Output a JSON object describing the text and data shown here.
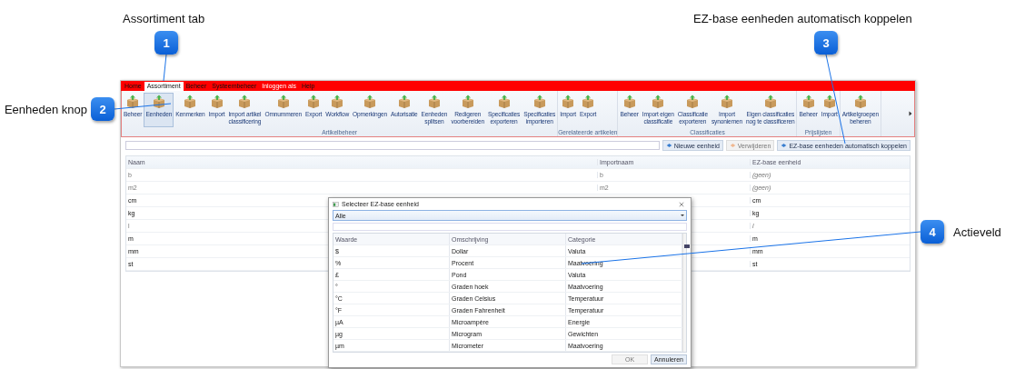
{
  "callouts": [
    {
      "number": "1",
      "label": "Assortiment tab"
    },
    {
      "number": "2",
      "label": "Eenheden knop"
    },
    {
      "number": "3",
      "label": "EZ-base eenheden automatisch koppelen"
    },
    {
      "number": "4",
      "label": "Actieveld"
    }
  ],
  "menu_tabs": [
    {
      "label": "Home",
      "selected": false,
      "disabled": false
    },
    {
      "label": "Assortiment",
      "selected": true,
      "disabled": false
    },
    {
      "label": "Beheer",
      "selected": false,
      "disabled": false
    },
    {
      "label": "Systeembeheer",
      "selected": false,
      "disabled": false
    },
    {
      "label": "Inloggen als",
      "selected": false,
      "disabled": true
    },
    {
      "label": "Help",
      "selected": false,
      "disabled": false
    }
  ],
  "ribbon_groups": [
    {
      "label": "Artikelbeheer",
      "buttons": [
        {
          "label": "Beheer",
          "selected": false
        },
        {
          "label": "Eenheden",
          "selected": true
        },
        {
          "label": "Kenmerken",
          "selected": false
        },
        {
          "label": "Import",
          "selected": false
        },
        {
          "label": "Import artikel\nclassificering",
          "selected": false
        },
        {
          "label": "Omnummeren",
          "selected": false
        },
        {
          "label": "Export",
          "selected": false
        },
        {
          "label": "Workflow",
          "selected": false
        },
        {
          "label": "Opmerkingen",
          "selected": false
        },
        {
          "label": "Autorisatie",
          "selected": false
        },
        {
          "label": "Eenheden\nsplitsen",
          "selected": false
        },
        {
          "label": "Redigeren\nvoorbereiden",
          "selected": false
        },
        {
          "label": "Specificaties\nexporteren",
          "selected": false
        },
        {
          "label": "Specificaties\nimporteren",
          "selected": false
        }
      ]
    },
    {
      "label": "Gerelateerde artikelen",
      "buttons": [
        {
          "label": "Import",
          "selected": false
        },
        {
          "label": "Export",
          "selected": false
        }
      ]
    },
    {
      "label": "Classificaties",
      "buttons": [
        {
          "label": "Beheer",
          "selected": false
        },
        {
          "label": "Import eigen\nclassificatie",
          "selected": false
        },
        {
          "label": "Classificatie\nexporteren",
          "selected": false
        },
        {
          "label": "Import\nsynoniemen",
          "selected": false
        },
        {
          "label": "Eigen classificaties\nnog te classificeren",
          "selected": false
        }
      ]
    },
    {
      "label": "Prijslijsten",
      "buttons": [
        {
          "label": "Beheer",
          "selected": false
        },
        {
          "label": "Import",
          "selected": false
        }
      ]
    },
    {
      "buttons": [
        {
          "label": "Artikelgroepen\nbeheren",
          "selected": false
        }
      ]
    }
  ],
  "toolbar": {
    "buttons": [
      {
        "label": "Nieuwe eenheid",
        "disabled": false
      },
      {
        "label": "Verwijderen",
        "disabled": true
      },
      {
        "label": "EZ-base eenheden automatisch koppelen",
        "disabled": false
      }
    ]
  },
  "table": {
    "columns": [
      "Naam",
      "Importnaam",
      "EZ-base eenheid"
    ],
    "rows": [
      {
        "naam": "b",
        "importnaam": "b",
        "ez_base": "(geen)",
        "disabled": true
      },
      {
        "naam": "m2",
        "importnaam": "m2",
        "ez_base": "(geen)",
        "disabled": true
      },
      {
        "naam": "cm",
        "ez_base": "cm",
        "disabled": false
      },
      {
        "naam": "kg",
        "ez_base": "kg",
        "disabled": false
      },
      {
        "naam": "l",
        "ez_base": "l",
        "disabled": true
      },
      {
        "naam": "m",
        "ez_base": "m",
        "disabled": false
      },
      {
        "naam": "mm",
        "ez_base": "mm",
        "disabled": false
      },
      {
        "naam": "st",
        "ez_base": "st",
        "disabled": false
      }
    ]
  },
  "dialog": {
    "title": "Selecteer EZ-base eenheid",
    "filter": "Alle",
    "columns": [
      "Waarde",
      "Omschrijving",
      "Categorie"
    ],
    "rows": [
      [
        "$",
        "Dollar",
        "Valuta"
      ],
      [
        "%",
        "Procent",
        "Maatvoering"
      ],
      [
        "£",
        "Pond",
        "Valuta"
      ],
      [
        "°",
        "Graden hoek",
        "Maatvoering"
      ],
      [
        "°C",
        "Graden Celsius",
        "Temperatuur"
      ],
      [
        "°F",
        "Graden Fahrenheit",
        "Temperatuur"
      ],
      [
        "µA",
        "Microampère",
        "Energie"
      ],
      [
        "µg",
        "Microgram",
        "Gewichten"
      ],
      [
        "µm",
        "Micrometer",
        "Maatvoering"
      ]
    ],
    "buttons": [
      {
        "label": "OK",
        "disabled": true
      },
      {
        "label": "Annuleren",
        "disabled": false
      }
    ]
  }
}
